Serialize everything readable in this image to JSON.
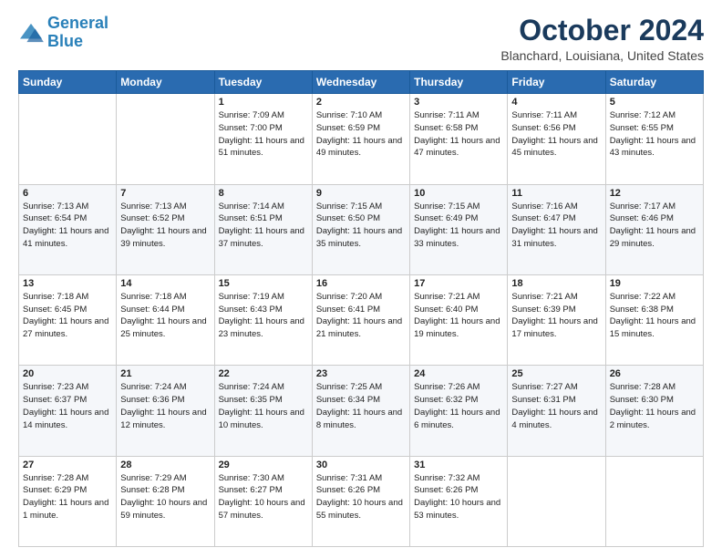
{
  "logo": {
    "line1": "General",
    "line2": "Blue"
  },
  "title": "October 2024",
  "location": "Blanchard, Louisiana, United States",
  "weekdays": [
    "Sunday",
    "Monday",
    "Tuesday",
    "Wednesday",
    "Thursday",
    "Friday",
    "Saturday"
  ],
  "weeks": [
    [
      {
        "day": "",
        "sunrise": "",
        "sunset": "",
        "daylight": ""
      },
      {
        "day": "",
        "sunrise": "",
        "sunset": "",
        "daylight": ""
      },
      {
        "day": "1",
        "sunrise": "Sunrise: 7:09 AM",
        "sunset": "Sunset: 7:00 PM",
        "daylight": "Daylight: 11 hours and 51 minutes."
      },
      {
        "day": "2",
        "sunrise": "Sunrise: 7:10 AM",
        "sunset": "Sunset: 6:59 PM",
        "daylight": "Daylight: 11 hours and 49 minutes."
      },
      {
        "day": "3",
        "sunrise": "Sunrise: 7:11 AM",
        "sunset": "Sunset: 6:58 PM",
        "daylight": "Daylight: 11 hours and 47 minutes."
      },
      {
        "day": "4",
        "sunrise": "Sunrise: 7:11 AM",
        "sunset": "Sunset: 6:56 PM",
        "daylight": "Daylight: 11 hours and 45 minutes."
      },
      {
        "day": "5",
        "sunrise": "Sunrise: 7:12 AM",
        "sunset": "Sunset: 6:55 PM",
        "daylight": "Daylight: 11 hours and 43 minutes."
      }
    ],
    [
      {
        "day": "6",
        "sunrise": "Sunrise: 7:13 AM",
        "sunset": "Sunset: 6:54 PM",
        "daylight": "Daylight: 11 hours and 41 minutes."
      },
      {
        "day": "7",
        "sunrise": "Sunrise: 7:13 AM",
        "sunset": "Sunset: 6:52 PM",
        "daylight": "Daylight: 11 hours and 39 minutes."
      },
      {
        "day": "8",
        "sunrise": "Sunrise: 7:14 AM",
        "sunset": "Sunset: 6:51 PM",
        "daylight": "Daylight: 11 hours and 37 minutes."
      },
      {
        "day": "9",
        "sunrise": "Sunrise: 7:15 AM",
        "sunset": "Sunset: 6:50 PM",
        "daylight": "Daylight: 11 hours and 35 minutes."
      },
      {
        "day": "10",
        "sunrise": "Sunrise: 7:15 AM",
        "sunset": "Sunset: 6:49 PM",
        "daylight": "Daylight: 11 hours and 33 minutes."
      },
      {
        "day": "11",
        "sunrise": "Sunrise: 7:16 AM",
        "sunset": "Sunset: 6:47 PM",
        "daylight": "Daylight: 11 hours and 31 minutes."
      },
      {
        "day": "12",
        "sunrise": "Sunrise: 7:17 AM",
        "sunset": "Sunset: 6:46 PM",
        "daylight": "Daylight: 11 hours and 29 minutes."
      }
    ],
    [
      {
        "day": "13",
        "sunrise": "Sunrise: 7:18 AM",
        "sunset": "Sunset: 6:45 PM",
        "daylight": "Daylight: 11 hours and 27 minutes."
      },
      {
        "day": "14",
        "sunrise": "Sunrise: 7:18 AM",
        "sunset": "Sunset: 6:44 PM",
        "daylight": "Daylight: 11 hours and 25 minutes."
      },
      {
        "day": "15",
        "sunrise": "Sunrise: 7:19 AM",
        "sunset": "Sunset: 6:43 PM",
        "daylight": "Daylight: 11 hours and 23 minutes."
      },
      {
        "day": "16",
        "sunrise": "Sunrise: 7:20 AM",
        "sunset": "Sunset: 6:41 PM",
        "daylight": "Daylight: 11 hours and 21 minutes."
      },
      {
        "day": "17",
        "sunrise": "Sunrise: 7:21 AM",
        "sunset": "Sunset: 6:40 PM",
        "daylight": "Daylight: 11 hours and 19 minutes."
      },
      {
        "day": "18",
        "sunrise": "Sunrise: 7:21 AM",
        "sunset": "Sunset: 6:39 PM",
        "daylight": "Daylight: 11 hours and 17 minutes."
      },
      {
        "day": "19",
        "sunrise": "Sunrise: 7:22 AM",
        "sunset": "Sunset: 6:38 PM",
        "daylight": "Daylight: 11 hours and 15 minutes."
      }
    ],
    [
      {
        "day": "20",
        "sunrise": "Sunrise: 7:23 AM",
        "sunset": "Sunset: 6:37 PM",
        "daylight": "Daylight: 11 hours and 14 minutes."
      },
      {
        "day": "21",
        "sunrise": "Sunrise: 7:24 AM",
        "sunset": "Sunset: 6:36 PM",
        "daylight": "Daylight: 11 hours and 12 minutes."
      },
      {
        "day": "22",
        "sunrise": "Sunrise: 7:24 AM",
        "sunset": "Sunset: 6:35 PM",
        "daylight": "Daylight: 11 hours and 10 minutes."
      },
      {
        "day": "23",
        "sunrise": "Sunrise: 7:25 AM",
        "sunset": "Sunset: 6:34 PM",
        "daylight": "Daylight: 11 hours and 8 minutes."
      },
      {
        "day": "24",
        "sunrise": "Sunrise: 7:26 AM",
        "sunset": "Sunset: 6:32 PM",
        "daylight": "Daylight: 11 hours and 6 minutes."
      },
      {
        "day": "25",
        "sunrise": "Sunrise: 7:27 AM",
        "sunset": "Sunset: 6:31 PM",
        "daylight": "Daylight: 11 hours and 4 minutes."
      },
      {
        "day": "26",
        "sunrise": "Sunrise: 7:28 AM",
        "sunset": "Sunset: 6:30 PM",
        "daylight": "Daylight: 11 hours and 2 minutes."
      }
    ],
    [
      {
        "day": "27",
        "sunrise": "Sunrise: 7:28 AM",
        "sunset": "Sunset: 6:29 PM",
        "daylight": "Daylight: 11 hours and 1 minute."
      },
      {
        "day": "28",
        "sunrise": "Sunrise: 7:29 AM",
        "sunset": "Sunset: 6:28 PM",
        "daylight": "Daylight: 10 hours and 59 minutes."
      },
      {
        "day": "29",
        "sunrise": "Sunrise: 7:30 AM",
        "sunset": "Sunset: 6:27 PM",
        "daylight": "Daylight: 10 hours and 57 minutes."
      },
      {
        "day": "30",
        "sunrise": "Sunrise: 7:31 AM",
        "sunset": "Sunset: 6:26 PM",
        "daylight": "Daylight: 10 hours and 55 minutes."
      },
      {
        "day": "31",
        "sunrise": "Sunrise: 7:32 AM",
        "sunset": "Sunset: 6:26 PM",
        "daylight": "Daylight: 10 hours and 53 minutes."
      },
      {
        "day": "",
        "sunrise": "",
        "sunset": "",
        "daylight": ""
      },
      {
        "day": "",
        "sunrise": "",
        "sunset": "",
        "daylight": ""
      }
    ]
  ]
}
